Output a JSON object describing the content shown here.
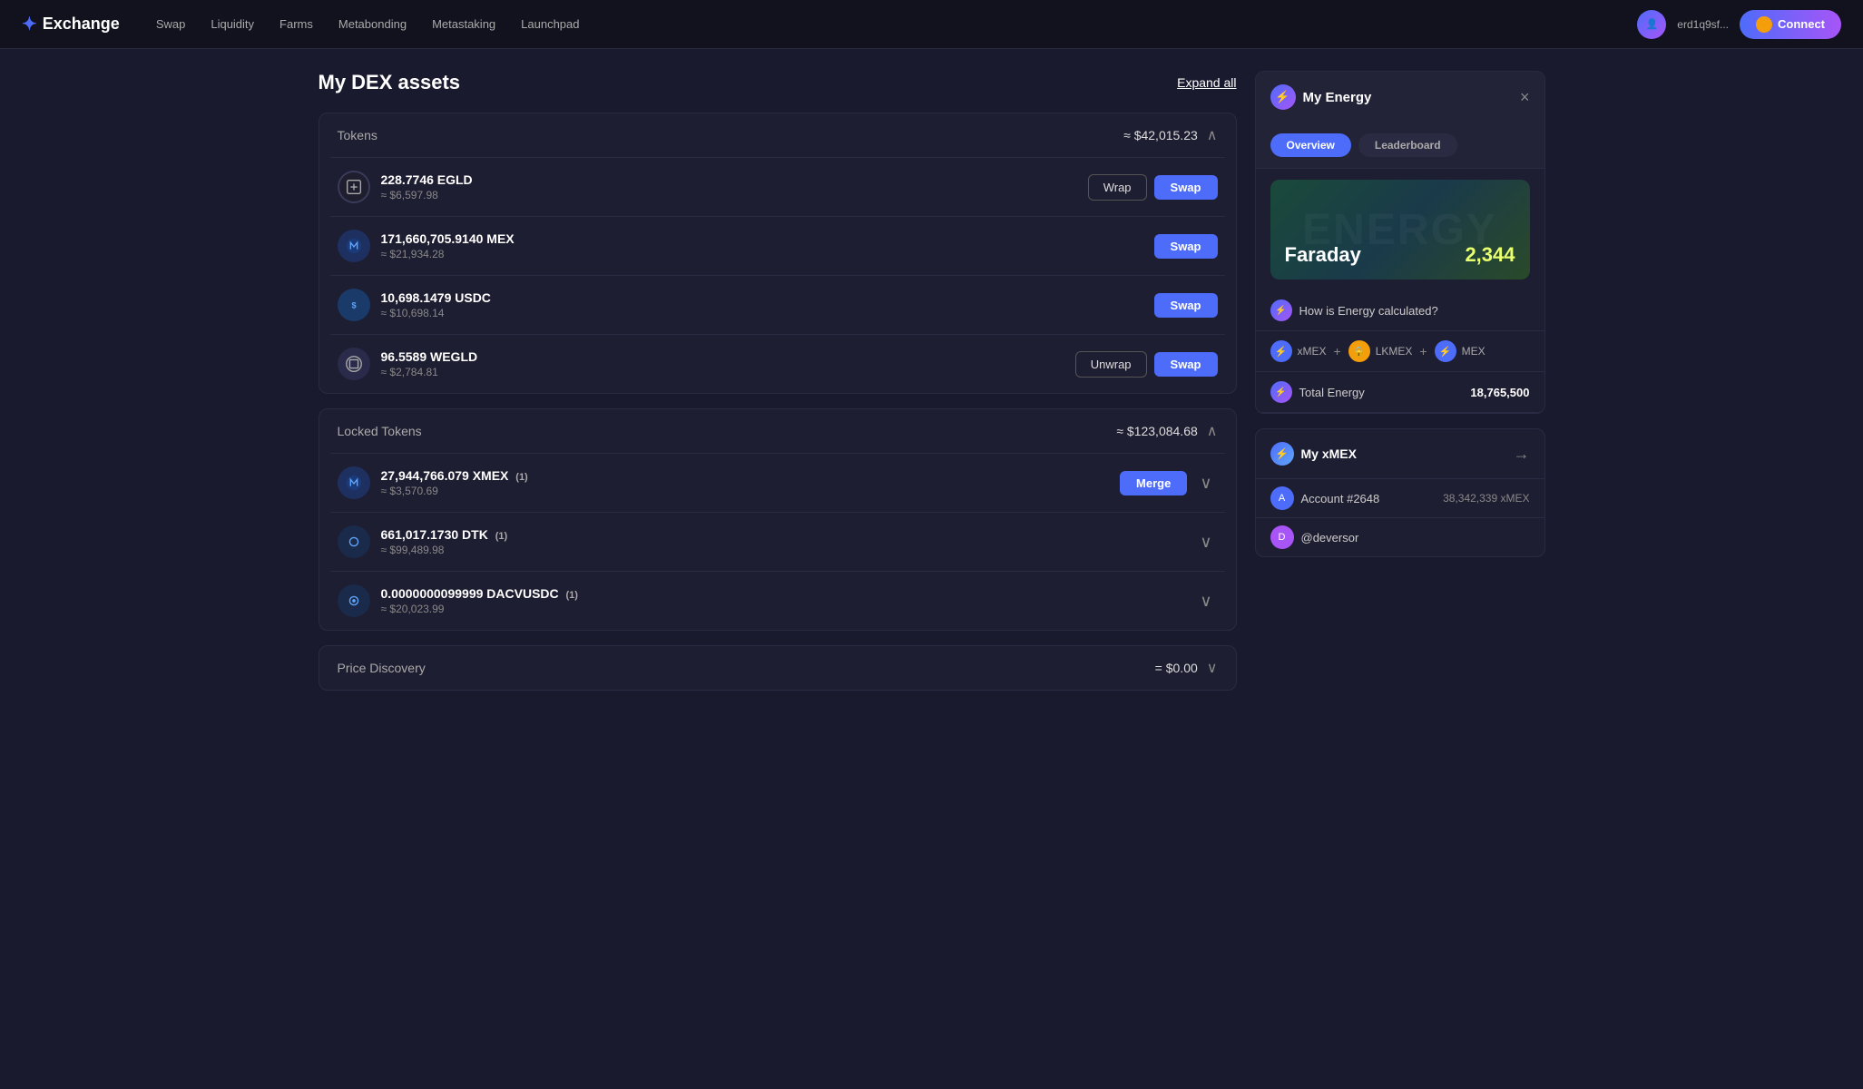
{
  "navbar": {
    "logo": "Exchange",
    "logo_prefix": "✦",
    "links": [
      "Swap",
      "Liquidity",
      "Farms",
      "Metabonding",
      "Metastaking",
      "Launchpad"
    ],
    "address": "erd1q9sf...",
    "connect_btn": "Connect",
    "coin_color": "#f59e0b"
  },
  "page": {
    "title": "My DEX assets",
    "expand_all": "Expand all"
  },
  "tokens_section": {
    "title": "Tokens",
    "total": "≈ $42,015.23",
    "tokens": [
      {
        "symbol": "EGLD",
        "amount": "228.7746 EGLD",
        "usd": "≈ $6,597.98",
        "actions": [
          "Wrap",
          "Swap"
        ],
        "icon_type": "egld"
      },
      {
        "symbol": "MEX",
        "amount": "171,660,705.9140 MEX",
        "usd": "≈ $21,934.28",
        "actions": [
          "Swap"
        ],
        "icon_type": "mex"
      },
      {
        "symbol": "USDC",
        "amount": "10,698.1479 USDC",
        "usd": "≈ $10,698.14",
        "actions": [
          "Swap"
        ],
        "icon_type": "usdc"
      },
      {
        "symbol": "WEGLD",
        "amount": "96.5589 WEGLD",
        "usd": "≈ $2,784.81",
        "actions": [
          "Unwrap",
          "Swap"
        ],
        "icon_type": "wegld"
      }
    ]
  },
  "locked_section": {
    "title": "Locked Tokens",
    "total": "≈ $123,084.68",
    "tokens": [
      {
        "symbol": "XMEX",
        "amount": "27,944,766.079 XMEX",
        "badge": "(1)",
        "usd": "≈ $3,570.69",
        "actions": [
          "Merge"
        ],
        "has_expand": true,
        "icon_type": "xmex"
      },
      {
        "symbol": "DTK",
        "amount": "661,017.1730 DTK",
        "badge": "(1)",
        "usd": "≈ $99,489.98",
        "actions": [],
        "has_expand": true,
        "icon_type": "dtk"
      },
      {
        "symbol": "DACVUSDC",
        "amount": "0.0000000099999 DACVUSDC",
        "badge": "(1)",
        "usd": "≈ $20,023.99",
        "actions": [],
        "has_expand": true,
        "icon_type": "dacvusdc"
      }
    ]
  },
  "price_discovery_section": {
    "title": "Price Discovery",
    "total": "= $0.00"
  },
  "right_panel": {
    "my_energy": {
      "title": "My Energy",
      "tabs": [
        "Overview",
        "Leaderboard"
      ],
      "active_tab": "Overview",
      "card_label": "Faraday",
      "card_value": "2,344",
      "card_bg_text": "ENERGY",
      "total_energy_label": "Total Energy",
      "total_energy_value": "18,765,500",
      "how_calculated": "How is Energy calculated?",
      "stat_items": [
        {
          "label": "xMEX",
          "color": "#4d6cfa"
        },
        {
          "label": "LKMEX",
          "color": "#f59e0b"
        },
        {
          "label": "MEX",
          "color": "#4d6cfa"
        }
      ]
    },
    "my_xmex": {
      "title": "My xMEX",
      "arrow": "→"
    },
    "leaderboard_rows": [
      {
        "username": "Account #2648",
        "value": "38,342,339 xMEX",
        "avatar_bg": "#4d6cfa"
      },
      {
        "username": "@deversor",
        "value": "",
        "avatar_bg": "#a855f7"
      }
    ]
  }
}
